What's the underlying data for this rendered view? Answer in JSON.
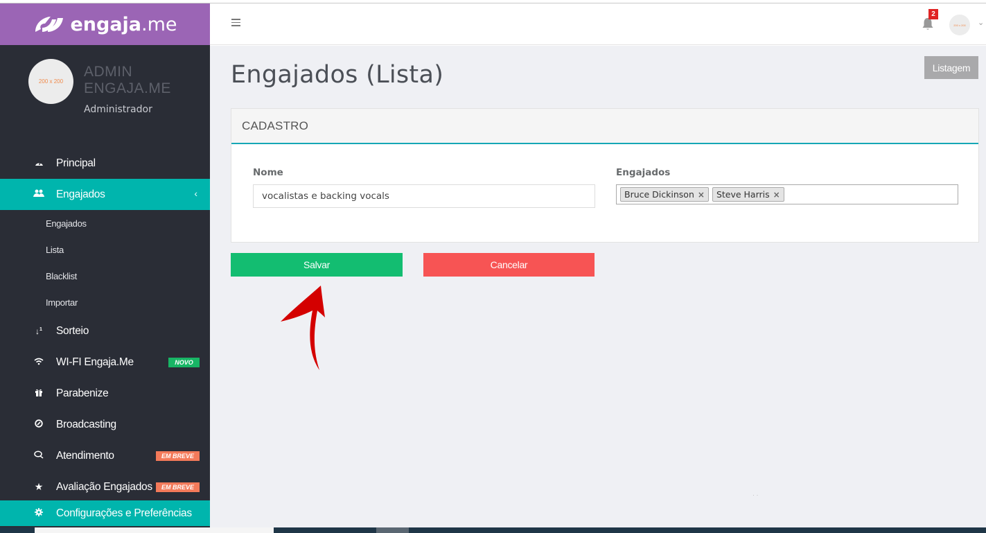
{
  "brand": {
    "name": "engaja",
    "tld": ".me"
  },
  "user": {
    "avatar_text": "200 x 200",
    "name": "ADMIN ENGAJA.ME",
    "role": "Administrador",
    "top_avatar_text": "200 x 200"
  },
  "notifications": {
    "count": "2"
  },
  "sidebar": {
    "items": [
      {
        "label": "Principal",
        "icon": "dashboard-icon"
      },
      {
        "label": "Engajados",
        "icon": "users-icon",
        "active": true
      },
      {
        "label": "Sorteio",
        "icon": "sort-numeric-icon"
      },
      {
        "label": "WI-FI Engaja.Me",
        "icon": "wifi-icon",
        "badge": "NOVO"
      },
      {
        "label": "Parabenize",
        "icon": "gift-icon"
      },
      {
        "label": "Broadcasting",
        "icon": "broadcast-icon"
      },
      {
        "label": "Atendimento",
        "icon": "chat-icon",
        "badge": "EM BREVE"
      },
      {
        "label": "Avaliação Engajados",
        "icon": "star-icon",
        "badge": "EM BREVE"
      },
      {
        "label": "Configurações e Preferências",
        "icon": "gear-icon"
      }
    ],
    "subitems": [
      "Engajados",
      "Lista",
      "Blacklist",
      "Importar"
    ]
  },
  "page": {
    "title": "Engajados (Lista)",
    "list_button": "Listagem"
  },
  "form": {
    "panel_title": "CADASTRO",
    "name_label": "Nome",
    "name_value": "vocalistas e  backing vocals",
    "engaged_label": "Engajados",
    "tags": [
      "Bruce Dickinson",
      "Steve Harris"
    ],
    "tag_remove": "×",
    "save_label": "Salvar",
    "cancel_label": "Cancelar"
  },
  "colors": {
    "brand": "#9b65b5",
    "sidebar": "#2a2d36",
    "accent": "#00b5ad",
    "save": "#13bd71",
    "cancel": "#f75454",
    "annotation_arrow": "#d40000"
  }
}
